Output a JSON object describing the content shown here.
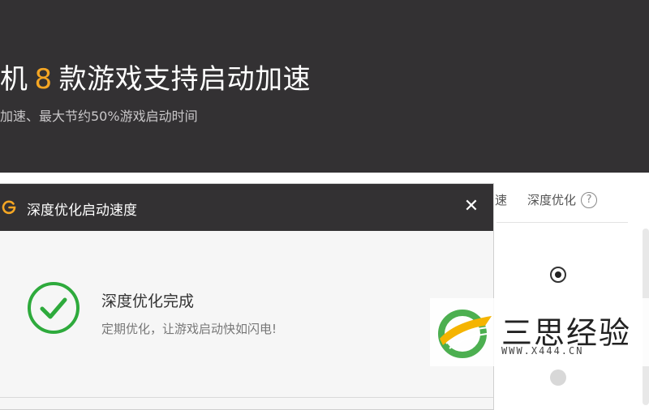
{
  "banner": {
    "title_prefix": "机",
    "title_number": "8",
    "title_suffix": "款游戏支持启动加速",
    "subtitle": "加速、最大节约50%游戏启动时间"
  },
  "tabs": {
    "partial_label": "速",
    "deep_optimize_label": "深度优化",
    "help_glyph": "?"
  },
  "dialog": {
    "title": "深度优化启动速度",
    "close_glyph": "✕",
    "done_title": "深度优化完成",
    "done_message": "定期优化，让游戏启动快如闪电!"
  },
  "watermark": {
    "text": "三思经验",
    "url": "WWW.X444.CN"
  },
  "colors": {
    "header_bg": "#333133",
    "accent_orange": "#f5a623",
    "success_green": "#2eaa3c"
  },
  "icons": {
    "dialog_logo": "orange-g-logo-icon",
    "success": "checkmark-circle-icon",
    "close": "close-icon",
    "help": "question-circle-icon"
  }
}
